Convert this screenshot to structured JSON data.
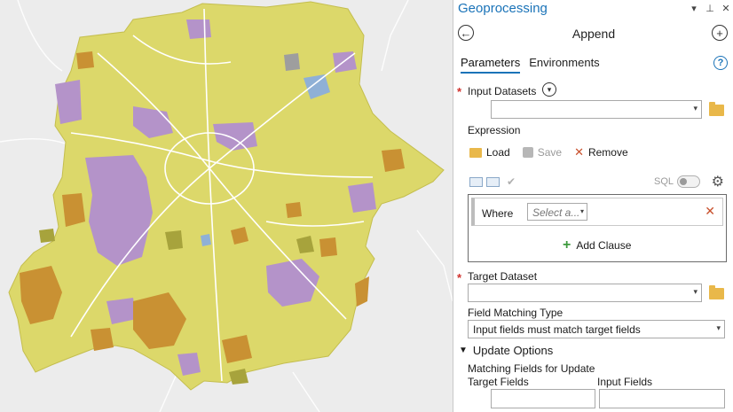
{
  "header": {
    "title": "Geoprocessing",
    "icons": [
      "chevron-down-icon",
      "pin-icon",
      "close-icon"
    ]
  },
  "tool": {
    "title": "Append",
    "back_icon": "back-arrow-icon",
    "add_icon": "add-icon",
    "tabs": [
      {
        "label": "Parameters",
        "active": true
      },
      {
        "label": "Environments",
        "active": false
      }
    ],
    "help_icon": "help-icon"
  },
  "params": {
    "input_datasets_label": "Input Datasets",
    "input_datasets_value": "",
    "expression_label": "Expression",
    "load_label": "Load",
    "save_label": "Save",
    "remove_label": "Remove",
    "sql_label": "SQL",
    "where_label": "Where",
    "field_placeholder": "Select a...",
    "add_clause_label": "Add Clause",
    "target_dataset_label": "Target Dataset",
    "target_dataset_value": "",
    "field_matching_label": "Field Matching Type",
    "field_matching_value": "Input fields must match target fields",
    "update_options_label": "Update Options",
    "matching_fields_label": "Matching Fields for Update",
    "target_fields_label": "Target Fields",
    "input_fields_label": "Input Fields"
  },
  "colors": {
    "accent": "#1a73b8",
    "required": "#d0312d",
    "remove": "#c8502c",
    "add": "#3d9a3d",
    "map_yellow": "#dcd86a",
    "map_orange": "#c99133",
    "map_purple": "#b493c9",
    "map_blue": "#8fb0d6",
    "map_olive": "#a7a33c"
  }
}
